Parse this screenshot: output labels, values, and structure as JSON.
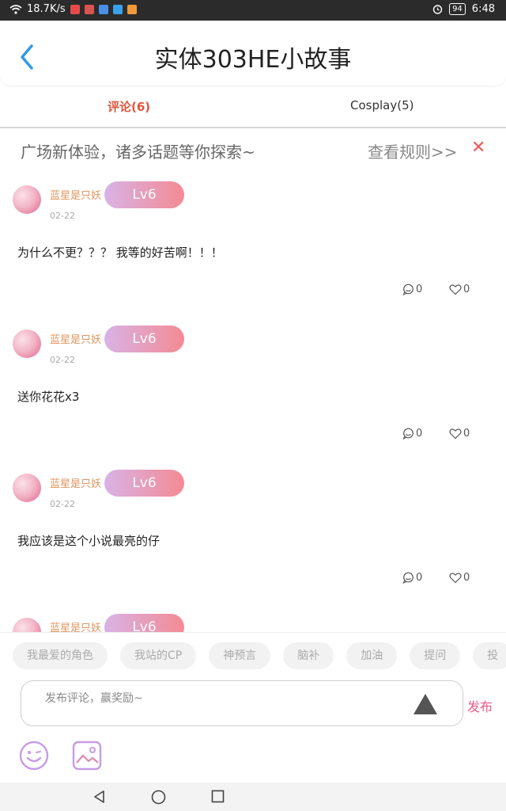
{
  "status_bar": {
    "speed": "18.7K/s",
    "battery": "94",
    "time": "6:48"
  },
  "header": {
    "title": "实体303HE小故事"
  },
  "tabs": [
    {
      "label": "评论(6)",
      "active": true
    },
    {
      "label": "Cosplay(5)",
      "active": false
    }
  ],
  "notice": {
    "text": "广场新体验，诸多话题等你探索~",
    "rules": "查看规则>>",
    "close": "✕"
  },
  "comments": [
    {
      "user": "蓝星是只妖",
      "level": "Lv6",
      "date": "02-22",
      "content": "为什么不更？？？ 我等的好苦啊！！！",
      "replies": "0",
      "likes": "0"
    },
    {
      "user": "蓝星是只妖",
      "level": "Lv6",
      "date": "02-22",
      "content": "送你花花x3",
      "replies": "0",
      "likes": "0"
    },
    {
      "user": "蓝星是只妖",
      "level": "Lv6",
      "date": "02-22",
      "content": "我应该是这个小说最亮的仔",
      "replies": "0",
      "likes": "0"
    },
    {
      "user": "蓝星是只妖",
      "level": "Lv6"
    }
  ],
  "quick_topics": [
    "我最爱的角色",
    "我站的CP",
    "神预言",
    "脑补",
    "加油",
    "提问",
    "投"
  ],
  "composer": {
    "placeholder": "发布评论，赢奖励~",
    "publish": "发布"
  },
  "colors": {
    "accent": "#e0553b",
    "username": "#e3955f",
    "publish": "#ea5a86",
    "level_from": "#d8b3e6",
    "level_to": "#f48a94"
  }
}
